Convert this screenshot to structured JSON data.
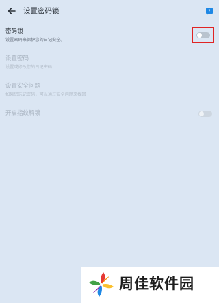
{
  "header": {
    "title": "设置密码锁",
    "back_icon": "arrow-left-icon",
    "help_icon": "help-chat-icon",
    "help_glyph": "?"
  },
  "settings": [
    {
      "title": "密码锁",
      "description": "设置密码来保护您的日记安全。",
      "enabled": true,
      "toggle": {
        "checked": false
      }
    },
    {
      "title": "设置密码",
      "description": "设置或修改您的日记密码",
      "enabled": false
    },
    {
      "title": "设置安全问题",
      "description": "如果您忘记密码，可以通过安全问题来找回",
      "enabled": false
    },
    {
      "title": "开启指纹解锁",
      "description": "",
      "enabled": false,
      "toggle": {
        "checked": false
      }
    }
  ],
  "watermark": {
    "text": "周佳软件园",
    "logo_icon": "pinwheel-logo-icon"
  },
  "colors": {
    "background": "#dbe6f3",
    "accent": "#1e88e5",
    "highlight": "#e02424"
  }
}
